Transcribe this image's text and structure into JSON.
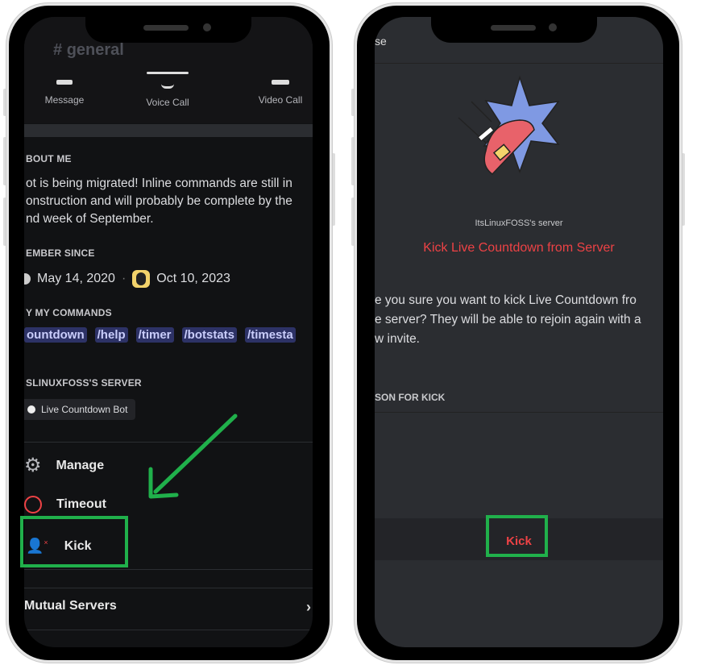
{
  "left": {
    "channel": "general",
    "actions": [
      "Message",
      "Voice Call",
      "Video Call"
    ],
    "about_title": "BOUT ME",
    "about_text": [
      "ot is being migrated! Inline commands are still in",
      "onstruction and will probably be complete by the",
      "nd week of September."
    ],
    "member_title": "EMBER SINCE",
    "date1": "May 14, 2020",
    "date2": "Oct 10, 2023",
    "commands_title": "Y MY COMMANDS",
    "commands": [
      "ountdown",
      "/help",
      "/timer",
      "/botstats",
      "/timesta"
    ],
    "server_title": "SLINUXFOSS'S SERVER",
    "role": "Live Countdown Bot",
    "menu": {
      "manage": "Manage",
      "timeout": "Timeout",
      "kick": "Kick"
    },
    "mutual": "Mutual Servers"
  },
  "right": {
    "close_partial": "se",
    "server_name": "ItsLinuxFOSS's server",
    "title": "Kick Live Countdown from Server",
    "message": [
      "e you sure you want to kick Live Countdown fro",
      "e server? They will be able to rejoin again with a",
      "w invite."
    ],
    "reason_label": "SON FOR KICK",
    "kick_button": "Kick"
  },
  "colors": {
    "highlight": "#20b04b",
    "danger": "#ed4245",
    "arrow": "#20b04b"
  }
}
